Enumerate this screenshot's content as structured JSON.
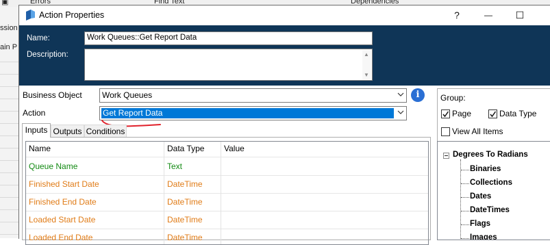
{
  "background": {
    "toolbar": {
      "errors": "Errors",
      "find": "Find Text",
      "deps": "Dependencies"
    },
    "left_tabs": [
      "ssion",
      "ain P"
    ]
  },
  "dialog": {
    "title": "Action Properties",
    "help_glyph": "?",
    "minimize_glyph": "—",
    "maximize_glyph": "☐",
    "name_label": "Name:",
    "name_value": "Work Queues::Get Report Data",
    "description_label": "Description:",
    "description_value": "",
    "business_object_label": "Business Object",
    "business_object_value": "Work Queues",
    "action_label": "Action",
    "action_value": "Get Report Data",
    "tabs": [
      "Inputs",
      "Outputs",
      "Conditions"
    ],
    "active_tab": "Inputs",
    "grid": {
      "headers": [
        "Name",
        "Data Type",
        "Value"
      ],
      "rows": [
        {
          "name": "Queue Name",
          "type": "Text",
          "value": "",
          "color": "#138a13"
        },
        {
          "name": "Finished Start Date",
          "type": "DateTime",
          "value": "",
          "color": "#e07b16"
        },
        {
          "name": "Finished End Date",
          "type": "DateTime",
          "value": "",
          "color": "#e07b16"
        },
        {
          "name": "Loaded Start Date",
          "type": "DateTime",
          "value": "",
          "color": "#e07b16"
        },
        {
          "name": "Loaded End Date",
          "type": "DateTime",
          "value": "",
          "color": "#e07b16"
        }
      ]
    },
    "group": {
      "label": "Group:",
      "page_label": "Page",
      "page_checked": true,
      "datatype_label": "Data Type",
      "datatype_checked": true,
      "viewall_label": "View All Items",
      "viewall_checked": false
    },
    "tree": {
      "root": "Degrees To Radians",
      "children": [
        "Binaries",
        "Collections",
        "Dates",
        "DateTimes",
        "Flags",
        "Images"
      ]
    }
  },
  "colors": {
    "header_bg": "#0f3557",
    "selection": "#0078d7",
    "text_green": "#138a13",
    "text_orange": "#e07b16",
    "annotation_red": "#e0202a"
  },
  "icons": {
    "app": "blueprism-icon",
    "info": "info-icon",
    "dropdown": "chevron-down-icon",
    "check": "checkmark-icon",
    "tree_collapse": "minus-icon"
  }
}
